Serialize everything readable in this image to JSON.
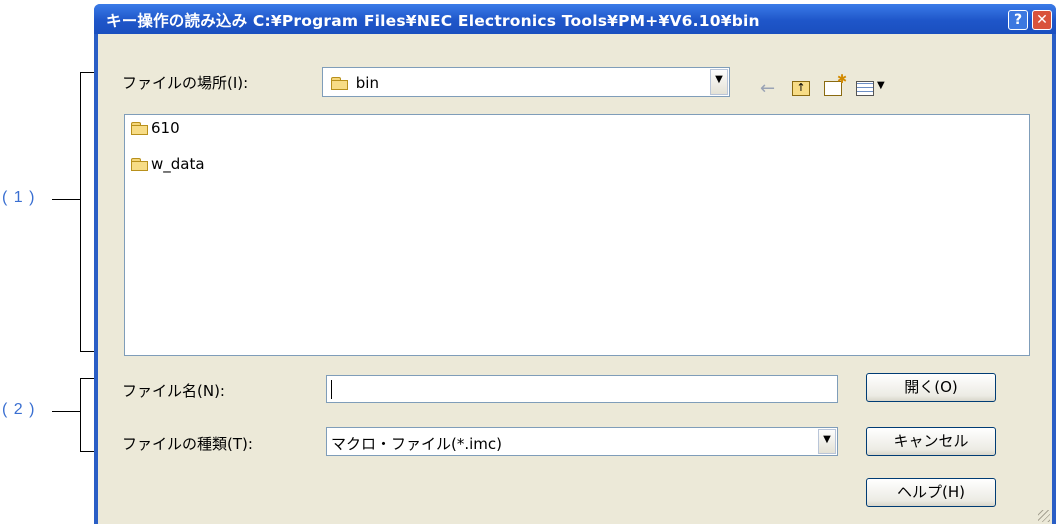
{
  "window": {
    "title": "キー操作の読み込み C:¥Program Files¥NEC Electronics Tools¥PM+¥V6.10¥bin"
  },
  "titlebar_buttons": {
    "help": "?",
    "close": "✕"
  },
  "location": {
    "label": "ファイルの場所(I):",
    "value": "bin"
  },
  "toolbar_icons": [
    "back-arrow-icon",
    "up-folder-icon",
    "new-folder-icon",
    "view-menu-icon"
  ],
  "files": [
    {
      "name": "610",
      "icon": "folder-icon"
    },
    {
      "name": "w_data",
      "icon": "folder-icon"
    }
  ],
  "filename": {
    "label": "ファイル名(N):",
    "value": ""
  },
  "filetype": {
    "label": "ファイルの種類(T):",
    "value": "マクロ・ファイル(*.imc)"
  },
  "buttons": {
    "open": "開く(O)",
    "cancel": "キャンセル",
    "help": "ヘルプ(H)"
  },
  "annotations": {
    "one": "( 1 )",
    "two": "( 2 )"
  }
}
